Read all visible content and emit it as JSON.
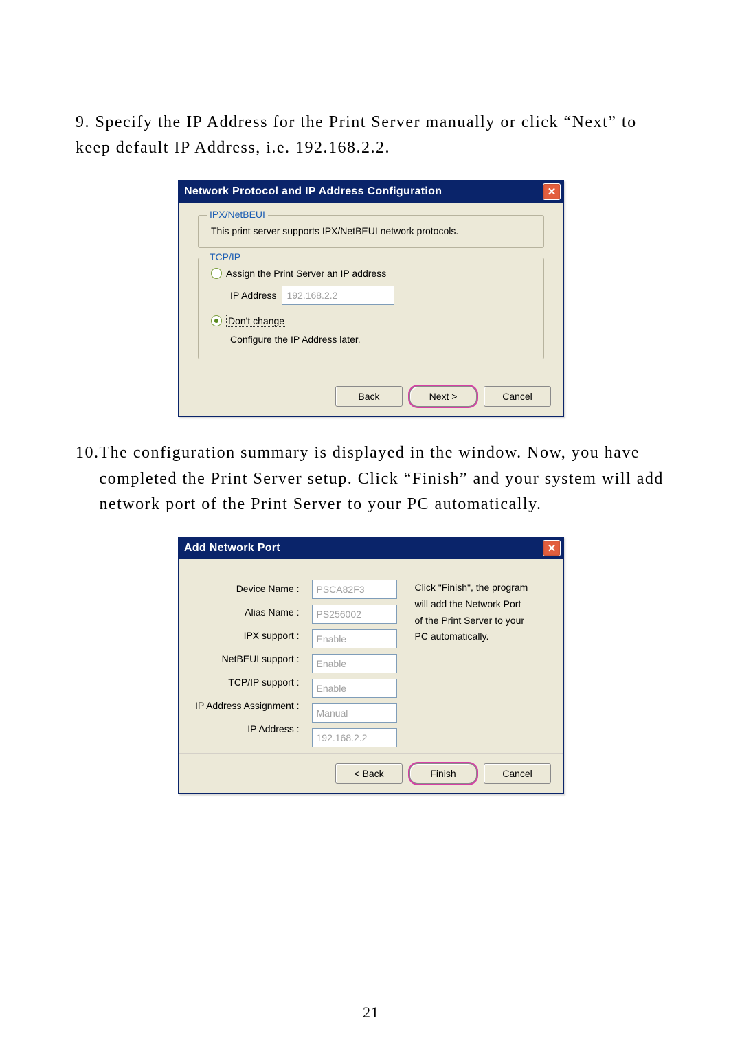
{
  "step9": {
    "num": "9.",
    "text": "Specify the IP Address for the Print Server manually or click “Next” to keep default IP Address, i.e. 192.168.2.2."
  },
  "dialog1": {
    "title": "Network Protocol and IP Address Configuration",
    "close_glyph": "✕",
    "group_ipx": {
      "title": "IPX/NetBEUI",
      "text": "This print server supports IPX/NetBEUI network protocols."
    },
    "group_tcp": {
      "title": "TCP/IP",
      "radio_assign": "Assign the Print Server an IP address",
      "ip_label": "IP Address",
      "ip_value": "192.168.2.2",
      "radio_dont": "Don't change",
      "sub": "Configure the IP Address later."
    },
    "buttons": {
      "back": "< Back",
      "next": "Next >",
      "cancel": "Cancel"
    }
  },
  "step10": {
    "num": "10.",
    "text": "The configuration summary is displayed in the window. Now, you have completed the Print Server setup. Click “Finish” and your system will add network port of the Print Server to your PC automatically."
  },
  "dialog2": {
    "title": "Add Network Port",
    "close_glyph": "✕",
    "labels": {
      "device": "Device Name :",
      "alias": "Alias Name :",
      "ipx": "IPX support :",
      "netbeui": "NetBEUI support :",
      "tcpip": "TCP/IP support :",
      "assign": "IP Address Assignment :",
      "ip": "IP Address :"
    },
    "values": {
      "device": "PSCA82F3",
      "alias": "PS256002",
      "ipx": "Enable",
      "netbeui": "Enable",
      "tcpip": "Enable",
      "assign": "Manual",
      "ip": "192.168.2.2"
    },
    "side": {
      "l1": "Click \"Finish\", the program",
      "l2": "will add the Network Port",
      "l3": "of the Print Server to your",
      "l4": "PC automatically."
    },
    "buttons": {
      "back": "< Back",
      "finish": "Finish",
      "cancel": "Cancel"
    }
  },
  "page_number": "21"
}
